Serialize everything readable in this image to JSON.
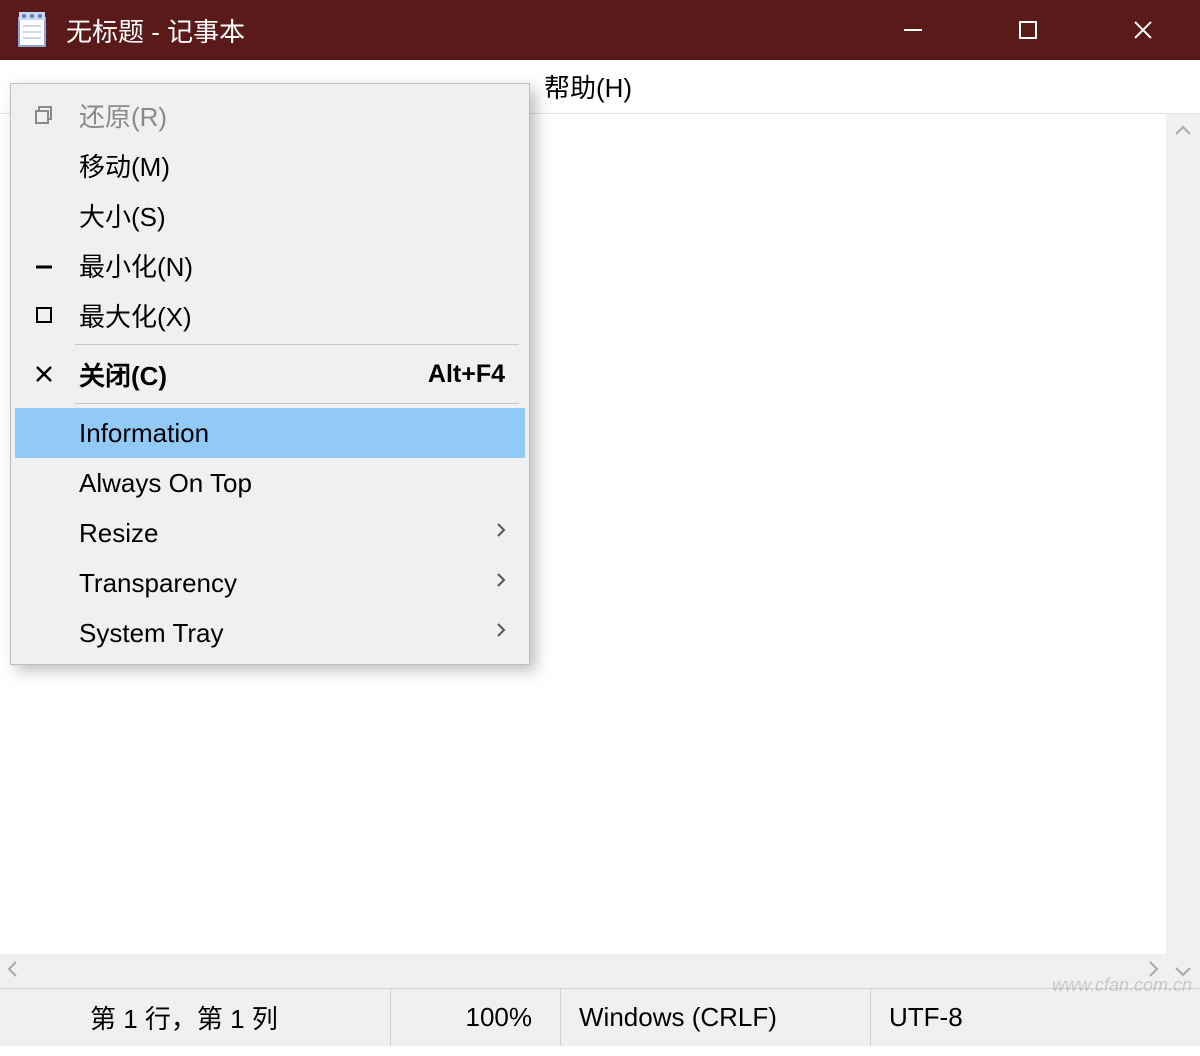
{
  "titlebar": {
    "title": "无标题 - 记事本"
  },
  "menubar": {
    "help": "帮助(H)"
  },
  "context_menu": {
    "items": [
      {
        "label": "还原(R)",
        "icon": "restore",
        "disabled": true
      },
      {
        "label": "移动(M)"
      },
      {
        "label": "大小(S)"
      },
      {
        "label": "最小化(N)",
        "icon": "minimize"
      },
      {
        "label": "最大化(X)",
        "icon": "maximize"
      },
      {
        "sep": true
      },
      {
        "label": "关闭(C)",
        "icon": "close",
        "shortcut": "Alt+F4",
        "bold": true
      },
      {
        "sep": true
      },
      {
        "label": "Information",
        "highlight": true
      },
      {
        "label": "Always On Top"
      },
      {
        "label": "Resize",
        "submenu": true
      },
      {
        "label": "Transparency",
        "submenu": true
      },
      {
        "label": "System Tray",
        "submenu": true
      }
    ]
  },
  "statusbar": {
    "position": "第 1 行，第 1 列",
    "zoom": "100%",
    "eol": "Windows (CRLF)",
    "encoding": "UTF-8"
  },
  "watermark": "www.cfan.com.cn"
}
